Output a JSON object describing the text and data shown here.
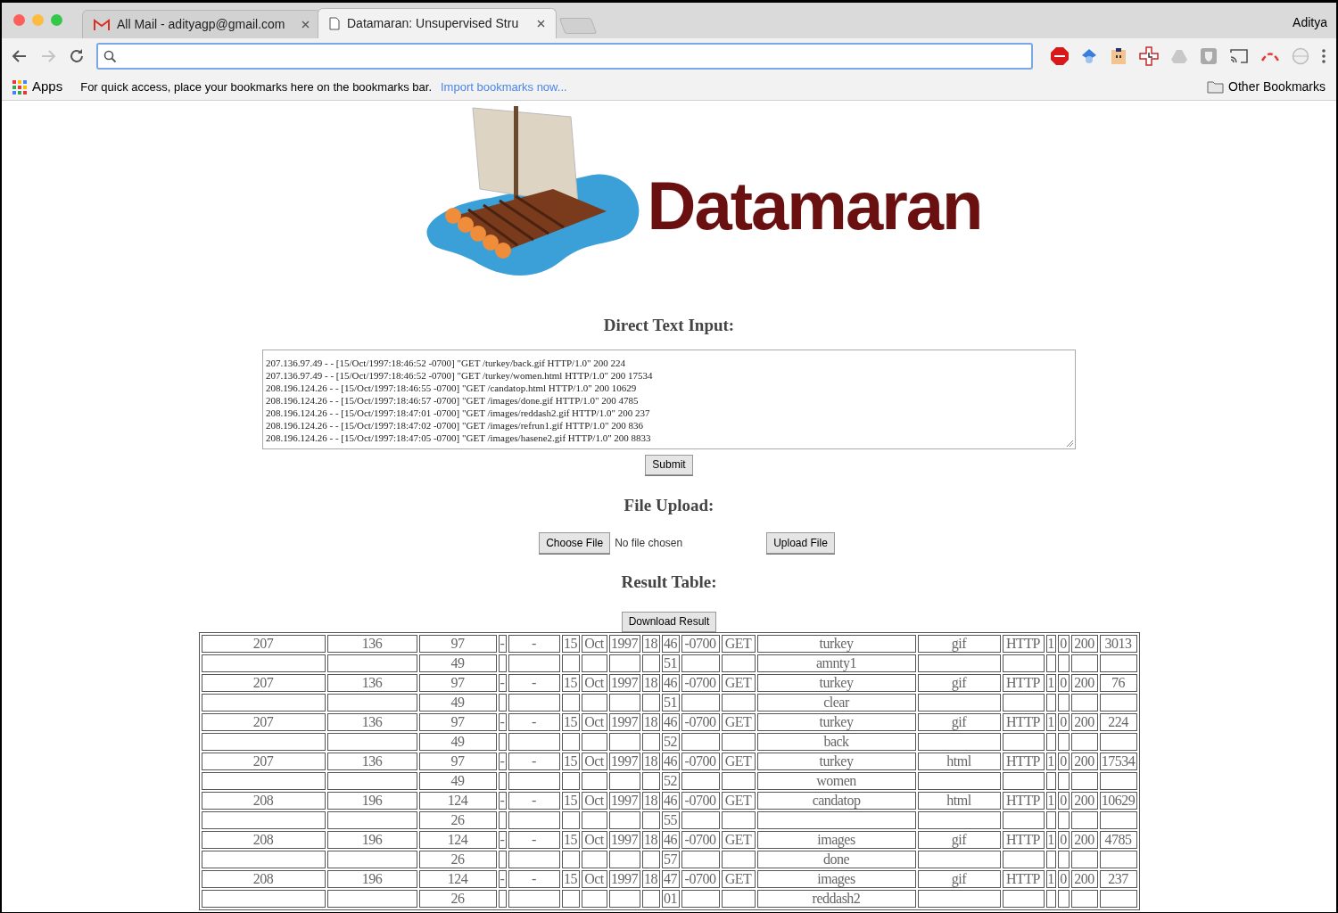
{
  "browser": {
    "tabs": [
      {
        "kind": "mail",
        "title": "All Mail - adityagp@gmail.com",
        "selected": false
      },
      {
        "kind": "page",
        "title": "Datamaran: Unsupervised Stru",
        "selected": true
      }
    ],
    "profile": "Aditya",
    "bookmarks_bar": {
      "apps": "Apps",
      "hint": "For quick access, place your bookmarks here on the bookmarks bar.",
      "import_link": "Import bookmarks now...",
      "other": "Other Bookmarks"
    }
  },
  "page": {
    "logo_text": "Datamaran",
    "text_input": {
      "heading": "Direct Text Input:",
      "lines": [
        "207.136.97.49 - - [15/Oct/1997:18:46:52 -0700] \"GET /turkey/back.gif HTTP/1.0\" 200 224",
        "207.136.97.49 - - [15/Oct/1997:18:46:52 -0700] \"GET /turkey/women.html HTTP/1.0\" 200 17534",
        "208.196.124.26 - - [15/Oct/1997:18:46:55 -0700] \"GET /candatop.html HTTP/1.0\" 200 10629",
        "208.196.124.26 - - [15/Oct/1997:18:46:57 -0700] \"GET /images/done.gif HTTP/1.0\" 200 4785",
        "208.196.124.26 - - [15/Oct/1997:18:47:01 -0700] \"GET /images/reddash2.gif HTTP/1.0\" 200 237",
        "208.196.124.26 - - [15/Oct/1997:18:47:02 -0700] \"GET /images/refrun1.gif HTTP/1.0\" 200 836",
        "208.196.124.26 - - [15/Oct/1997:18:47:05 -0700] \"GET /images/hasene2.gif HTTP/1.0\" 200 8833"
      ],
      "submit": "Submit"
    },
    "file_upload": {
      "heading": "File Upload:",
      "choose": "Choose File",
      "status": "No file chosen",
      "upload": "Upload File"
    },
    "result": {
      "heading": "Result Table:",
      "download": "Download Result",
      "rows": [
        [
          "207",
          "136",
          "97",
          "-",
          "-",
          "15",
          "Oct",
          "1997",
          "18",
          "46",
          "-0700",
          "GET",
          "turkey",
          "gif",
          "HTTP",
          "1",
          "0",
          "200",
          "3013"
        ],
        [
          null,
          null,
          "49",
          null,
          null,
          null,
          null,
          null,
          null,
          "51",
          null,
          null,
          "amnty1",
          null,
          null,
          null,
          null,
          null,
          null
        ],
        [
          "207",
          "136",
          "97",
          "-",
          "-",
          "15",
          "Oct",
          "1997",
          "18",
          "46",
          "-0700",
          "GET",
          "turkey",
          "gif",
          "HTTP",
          "1",
          "0",
          "200",
          "76"
        ],
        [
          null,
          null,
          "49",
          null,
          null,
          null,
          null,
          null,
          null,
          "51",
          null,
          null,
          "clear",
          null,
          null,
          null,
          null,
          null,
          null
        ],
        [
          "207",
          "136",
          "97",
          "-",
          "-",
          "15",
          "Oct",
          "1997",
          "18",
          "46",
          "-0700",
          "GET",
          "turkey",
          "gif",
          "HTTP",
          "1",
          "0",
          "200",
          "224"
        ],
        [
          null,
          null,
          "49",
          null,
          null,
          null,
          null,
          null,
          null,
          "52",
          null,
          null,
          "back",
          null,
          null,
          null,
          null,
          null,
          null
        ],
        [
          "207",
          "136",
          "97",
          "-",
          "-",
          "15",
          "Oct",
          "1997",
          "18",
          "46",
          "-0700",
          "GET",
          "turkey",
          "html",
          "HTTP",
          "1",
          "0",
          "200",
          "17534"
        ],
        [
          null,
          null,
          "49",
          null,
          null,
          null,
          null,
          null,
          null,
          "52",
          null,
          null,
          "women",
          null,
          null,
          null,
          null,
          null,
          null
        ],
        [
          "208",
          "196",
          "124",
          "-",
          "-",
          "15",
          "Oct",
          "1997",
          "18",
          "46",
          "-0700",
          "GET",
          "candatop",
          "html",
          "HTTP",
          "1",
          "0",
          "200",
          "10629"
        ],
        [
          null,
          null,
          "26",
          null,
          null,
          null,
          null,
          null,
          null,
          "55",
          null,
          null,
          null,
          null,
          null,
          null,
          null,
          null,
          null
        ],
        [
          "208",
          "196",
          "124",
          "-",
          "-",
          "15",
          "Oct",
          "1997",
          "18",
          "46",
          "-0700",
          "GET",
          "images",
          "gif",
          "HTTP",
          "1",
          "0",
          "200",
          "4785"
        ],
        [
          null,
          null,
          "26",
          null,
          null,
          null,
          null,
          null,
          null,
          "57",
          null,
          null,
          "done",
          null,
          null,
          null,
          null,
          null,
          null
        ],
        [
          "208",
          "196",
          "124",
          "-",
          "-",
          "15",
          "Oct",
          "1997",
          "18",
          "47",
          "-0700",
          "GET",
          "images",
          "gif",
          "HTTP",
          "1",
          "0",
          "200",
          "237"
        ],
        [
          null,
          null,
          "26",
          null,
          null,
          null,
          null,
          null,
          null,
          "01",
          null,
          null,
          "reddash2",
          null,
          null,
          null,
          null,
          null,
          null
        ]
      ]
    }
  }
}
